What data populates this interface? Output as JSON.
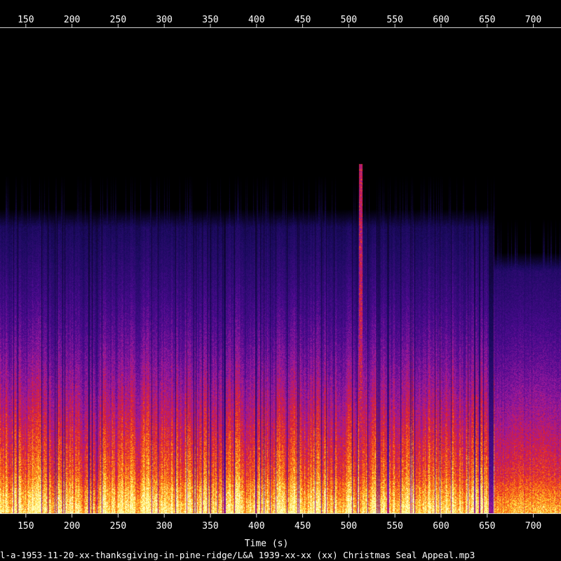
{
  "chart_data": {
    "type": "heatmap",
    "xlabel": "Time (s)",
    "filename": "l-a-1953-11-20-xx-thanksgiving-in-pine-ridge/L&A 1939-xx-xx (xx) Christmas Seal Appeal.mp3",
    "x_ticks": [
      150,
      200,
      250,
      300,
      350,
      400,
      450,
      500,
      550,
      600,
      650,
      700
    ],
    "xlim": [
      122,
      730
    ],
    "colormap": [
      "#000000",
      "#1a0a5e",
      "#4a0a8e",
      "#9e1a9e",
      "#e0202a",
      "#ff7a10",
      "#ffe040",
      "#ffffc0"
    ],
    "features": {
      "bandwidth_cutoff_fraction": 0.59,
      "post_break_time_s": 654,
      "post_break_cutoff_fraction": 0.5,
      "marker_time_s": 513
    },
    "grid": false
  }
}
